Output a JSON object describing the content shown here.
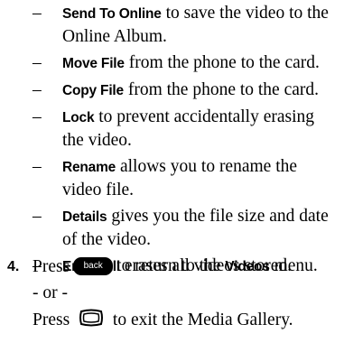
{
  "bullets": [
    {
      "dash": "–",
      "keyword": "Send To Online",
      "text": " to save the video to the Online Album."
    },
    {
      "dash": "–",
      "keyword": "Move File",
      "text": " from the phone to the card."
    },
    {
      "dash": "–",
      "keyword": "Copy File",
      "text": " from the phone to the card."
    },
    {
      "dash": "–",
      "keyword": "Lock",
      "text": " to prevent accidentally erasing the video."
    },
    {
      "dash": "–",
      "keyword": "Rename",
      "text": " allows you to rename the video file."
    },
    {
      "dash": "–",
      "keyword": "Details",
      "text": " gives you the file size and date of the video."
    },
    {
      "dash": "–",
      "keyword": "Erase All",
      "text": " erases all videos stored."
    }
  ],
  "step4": {
    "number": "4.",
    "press1": "Press",
    "back_key_label": "back",
    "after_back": " to return to the ",
    "menu_name": "Videos",
    "after_menu": " menu.",
    "or_text": "- or -",
    "press2": "Press",
    "end_key_icon": "end-key-icon",
    "after_end": " to exit the Media Gallery."
  }
}
